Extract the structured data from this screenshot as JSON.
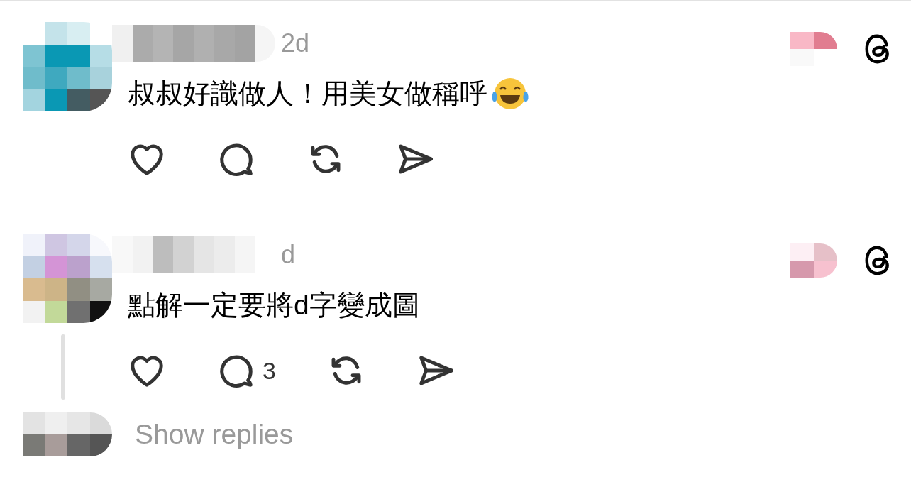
{
  "posts": [
    {
      "time": "2d",
      "text": "叔叔好識做人！用美女做稱呼",
      "emoji": true,
      "actions": [
        {
          "kind": "like"
        },
        {
          "kind": "reply"
        },
        {
          "kind": "repost"
        },
        {
          "kind": "share"
        }
      ],
      "thread_line": false
    },
    {
      "time": "d",
      "text": "點解一定要將d字變成圖",
      "emoji": false,
      "actions": [
        {
          "kind": "like"
        },
        {
          "kind": "reply",
          "count": "3"
        },
        {
          "kind": "repost"
        },
        {
          "kind": "share"
        }
      ],
      "thread_line": true
    }
  ],
  "show_replies": "Show replies"
}
